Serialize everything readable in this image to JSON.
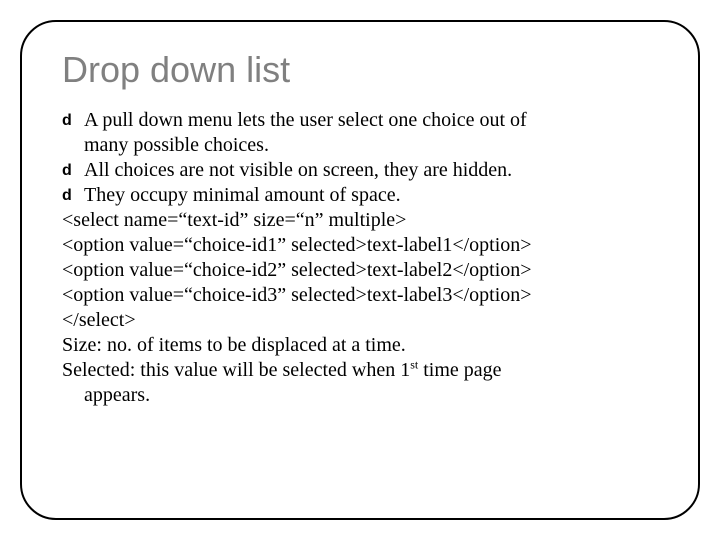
{
  "title": "Drop down list",
  "bullet_glyph": "d",
  "bullets": {
    "b1": "A pull down menu lets the user select one choice out of",
    "b1_cont": "many possible choices.",
    "b2": "All choices are not visible on screen, they are hidden.",
    "b3": "They occupy minimal amount of space."
  },
  "code": {
    "l1": "<select name=“text-id” size=“n” multiple>",
    "l2": "<option value=“choice-id1” selected>text-label1</option>",
    "l3": "<option value=“choice-id2” selected>text-label2</option>",
    "l4": "<option value=“choice-id3” selected>text-label3</option>",
    "l5": "</select>"
  },
  "notes": {
    "size": "Size: no. of items to be displaced at a time.",
    "selected_pre": "Selected: this  value will be selected when 1",
    "selected_sup": "st",
    "selected_post": " time page",
    "selected_line2": "appears."
  }
}
